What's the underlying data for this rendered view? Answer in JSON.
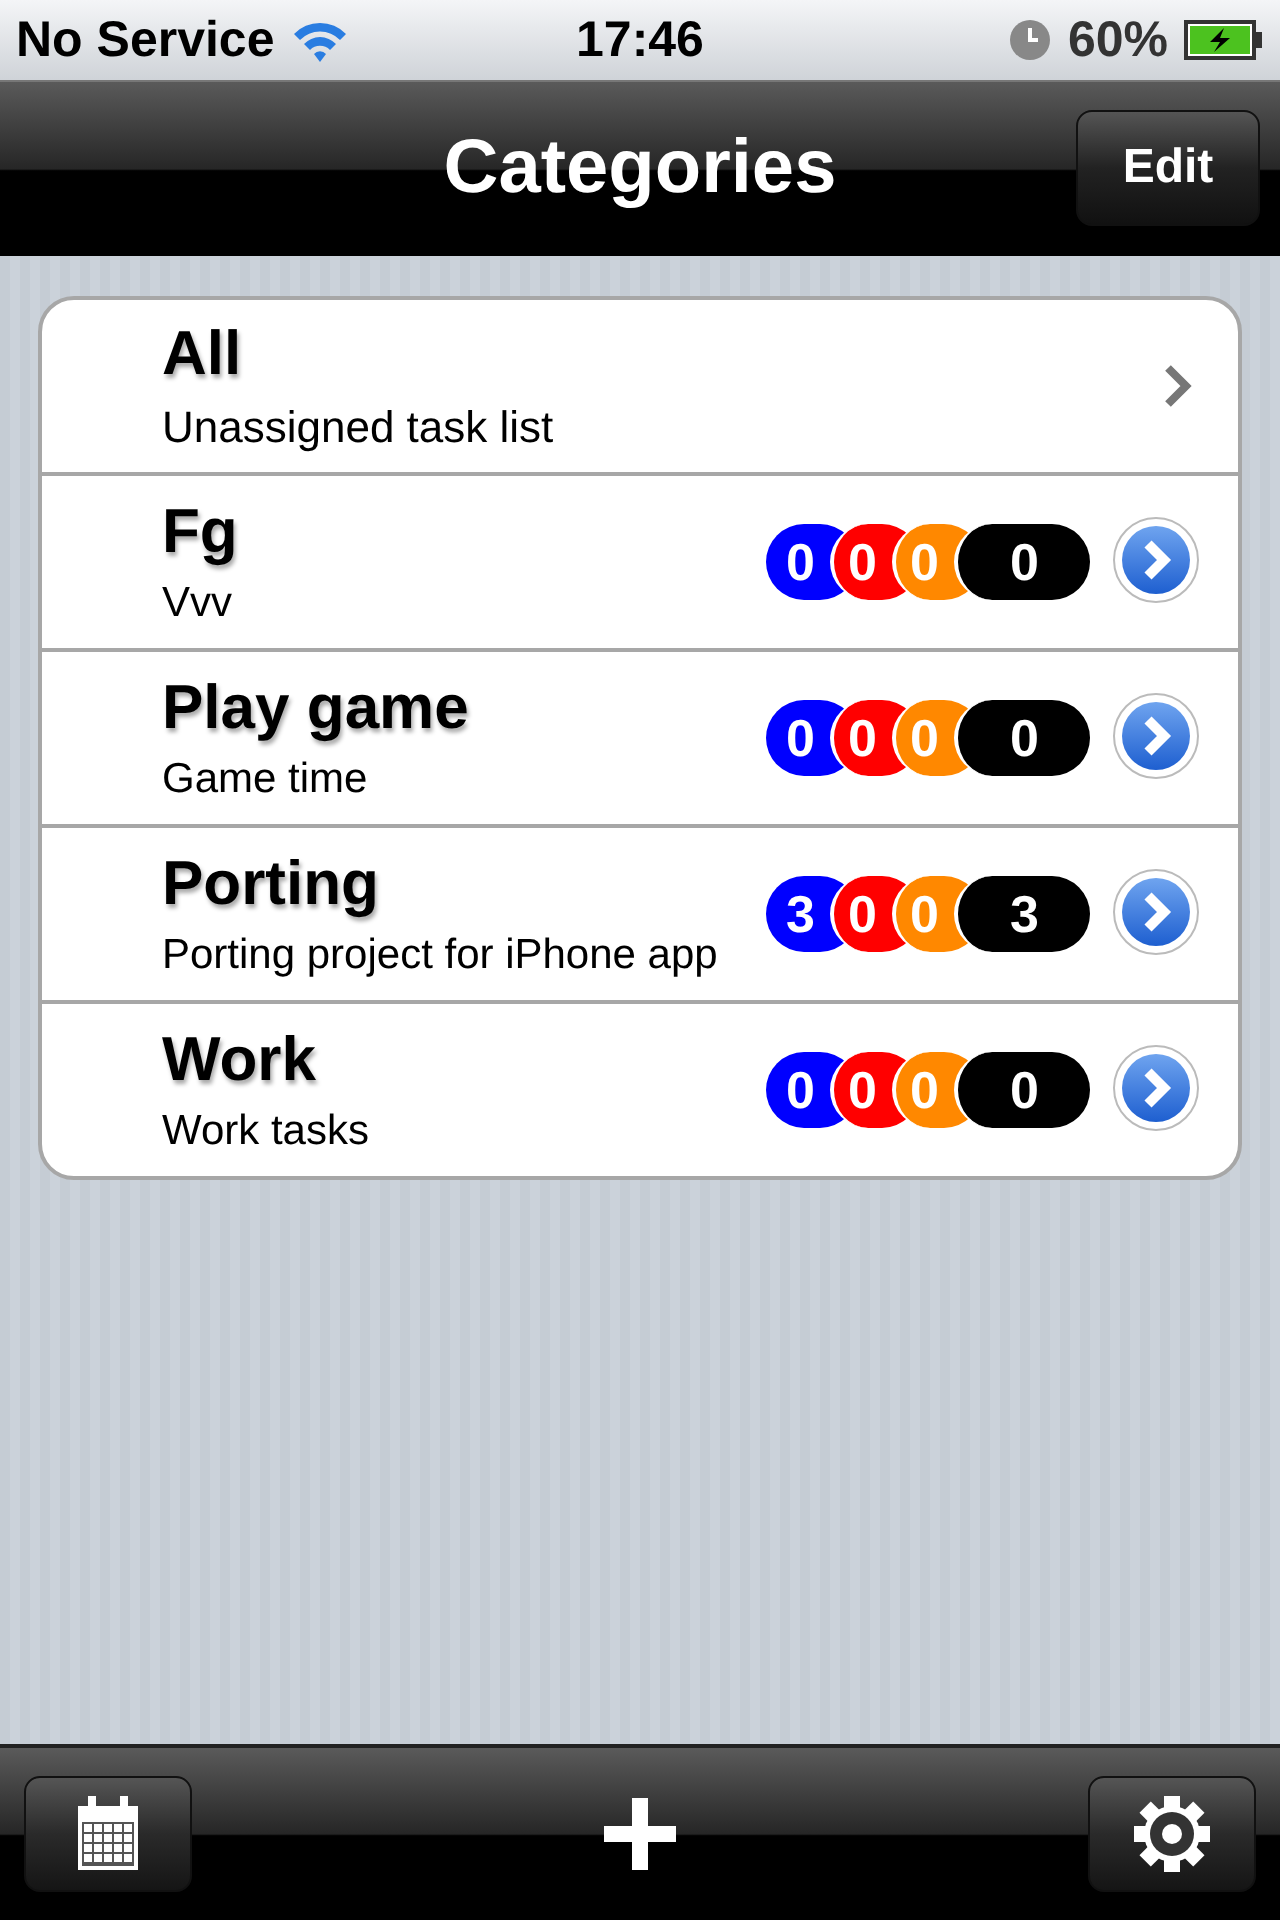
{
  "status_bar": {
    "carrier": "No Service",
    "time": "17:46",
    "battery": "60%"
  },
  "nav_bar": {
    "title": "Categories",
    "edit_button": "Edit"
  },
  "categories": [
    {
      "kind": "all",
      "name": "All",
      "subtitle": "Unassigned task list"
    },
    {
      "kind": "category",
      "name": "Fg",
      "subtitle": "Vvv",
      "badges": [
        {
          "count": "0",
          "color": "#0000ff"
        },
        {
          "count": "0",
          "color": "#ff0000"
        },
        {
          "count": "0",
          "color": "#ff8800"
        },
        {
          "count": "0",
          "color": "#000000"
        }
      ]
    },
    {
      "kind": "category",
      "name": "Play game",
      "subtitle": "Game time",
      "badges": [
        {
          "count": "0",
          "color": "#0000ff"
        },
        {
          "count": "0",
          "color": "#ff0000"
        },
        {
          "count": "0",
          "color": "#ff8800"
        },
        {
          "count": "0",
          "color": "#000000"
        }
      ]
    },
    {
      "kind": "category",
      "name": "Porting",
      "subtitle": "Porting project for iPhone app",
      "badges": [
        {
          "count": "3",
          "color": "#0000ff"
        },
        {
          "count": "0",
          "color": "#ff0000"
        },
        {
          "count": "0",
          "color": "#ff8800"
        },
        {
          "count": "3",
          "color": "#000000"
        }
      ]
    },
    {
      "kind": "category",
      "name": "Work",
      "subtitle": "Work tasks",
      "badges": [
        {
          "count": "0",
          "color": "#0000ff"
        },
        {
          "count": "0",
          "color": "#ff0000"
        },
        {
          "count": "0",
          "color": "#ff8800"
        },
        {
          "count": "0",
          "color": "#000000"
        }
      ]
    }
  ]
}
